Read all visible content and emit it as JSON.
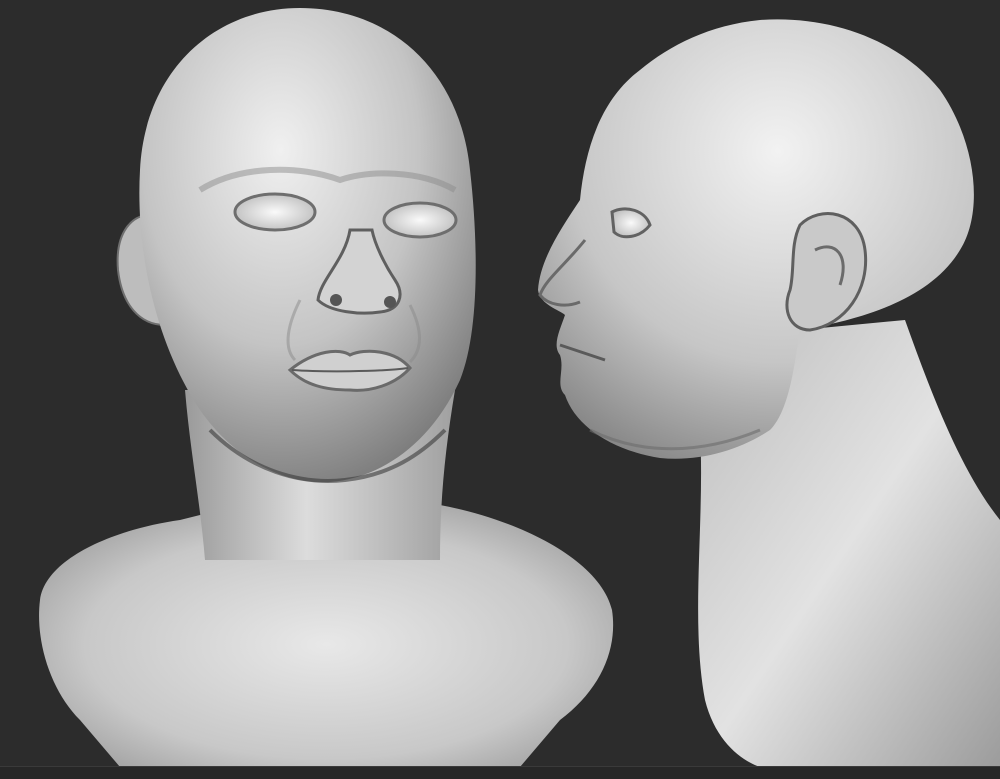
{
  "canvas": {
    "background": "#2c2c2c",
    "material_light": "#e6e6e6",
    "material_mid": "#a9a9a9",
    "material_dark": "#5a5a5a"
  },
  "subjects": [
    {
      "name": "front-view-head-bust"
    },
    {
      "name": "side-profile-head-bust"
    }
  ]
}
